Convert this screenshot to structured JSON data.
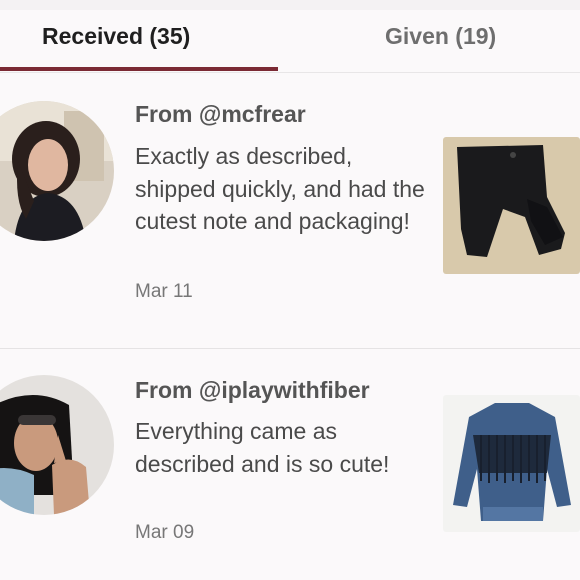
{
  "tabs": {
    "received_label": "Received (35)",
    "given_label": "Given (19)",
    "active": "received"
  },
  "reviews": [
    {
      "from": "From @mcfrear",
      "comment": "Exactly as described, shipped quickly, and had the cutest note and packaging!",
      "date": "Mar 11",
      "item_icon": "black-leggings-photo"
    },
    {
      "from": "From @iplaywithfiber",
      "comment": "Everything came as described and is so cute!",
      "date": "Mar 09",
      "item_icon": "denim-fringe-jacket-photo"
    }
  ],
  "colors": {
    "accent": "#7b2a34",
    "background": "#fbf9fa"
  }
}
